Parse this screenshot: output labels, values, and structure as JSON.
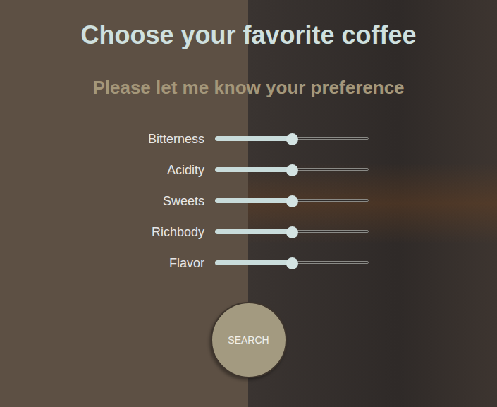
{
  "title": "Choose your favorite coffee",
  "subtitle": "Please let me know your preference",
  "sliders": [
    {
      "label": "Bitterness",
      "level": 0.5
    },
    {
      "label": "Acidity",
      "level": 0.5
    },
    {
      "label": "Sweets",
      "level": 0.5
    },
    {
      "label": "Richbody",
      "level": 0.5
    },
    {
      "label": "Flavor",
      "level": 0.5
    }
  ],
  "button": {
    "label": "SEARCH"
  }
}
